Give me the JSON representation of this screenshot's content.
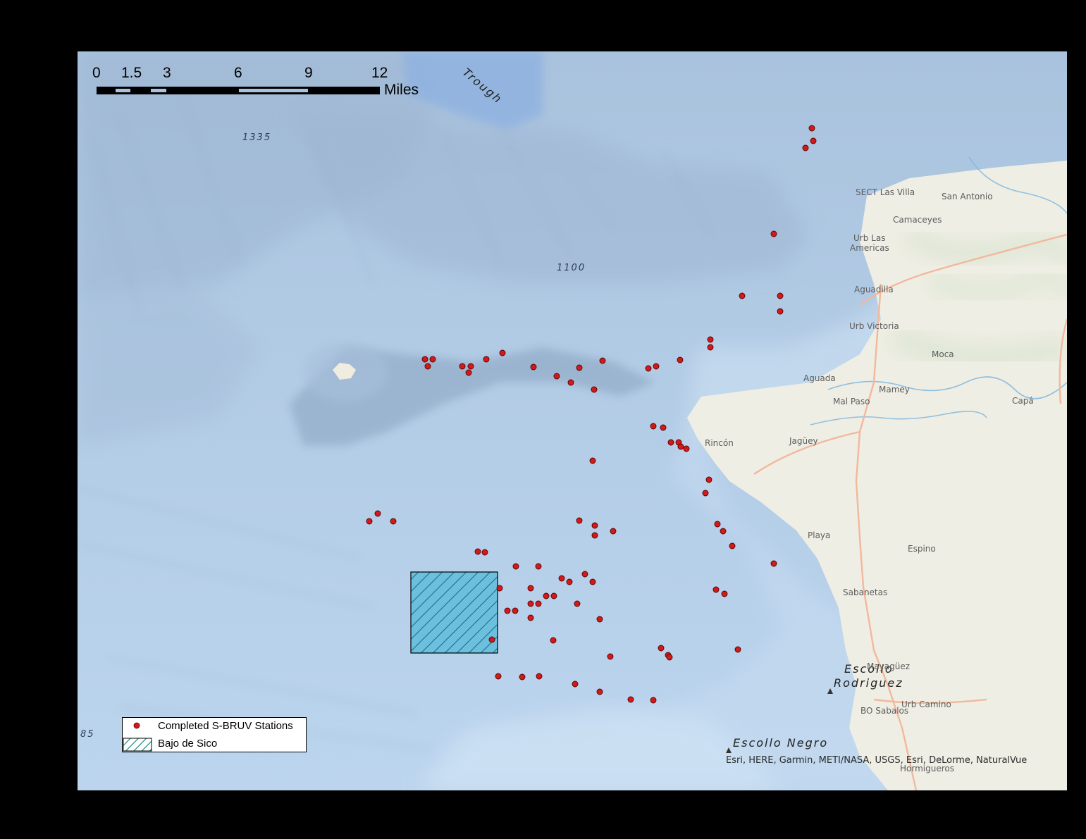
{
  "map": {
    "colors": {
      "ocean": "#b9d3ec",
      "shelf": "#cadff1",
      "trough": "#8fb2e0",
      "land": "#efeee4",
      "station": "#d11a1a",
      "study_area": "#6cc0de"
    },
    "scale_bar": {
      "ticks": [
        "0",
        "1.5",
        "3",
        "6",
        "9",
        "12"
      ],
      "unit": "Miles"
    },
    "depth_labels": [
      "1335",
      "1100",
      "85"
    ],
    "feature_labels": [
      "Trough",
      "Escollo",
      "Rodriguez",
      "Escollo Negro"
    ],
    "towns": [
      "SECT Las Villa",
      "San Antonio",
      "Camaceyes",
      "Urb Las",
      "Americas",
      "Aguadilla",
      "Urb Victoria",
      "Moca",
      "Aguada",
      "Mamey",
      "Mal Paso",
      "Capá",
      "Rincón",
      "Jagüey",
      "Playa",
      "Espino",
      "Sabanetas",
      "Mayagüez",
      "Urb Camino",
      "BO Sabalos",
      "Hormigueros"
    ],
    "attribution": "Esri, HERE, Garmin, METI/NASA, USGS, Esri, DeLorme, NaturalVue"
  },
  "legend": {
    "items": [
      {
        "label": "Completed S-BRUV Stations",
        "symbol": "red-dot"
      },
      {
        "label": "Bajo de Sico",
        "symbol": "hatched-box"
      }
    ]
  },
  "stations": [
    [
      1152,
      182
    ],
    [
      1154,
      200
    ],
    [
      1143,
      210
    ],
    [
      1098,
      332
    ],
    [
      1053,
      420
    ],
    [
      1107,
      420
    ],
    [
      1107,
      442
    ],
    [
      1008,
      482
    ],
    [
      1008,
      493
    ],
    [
      965,
      511
    ],
    [
      931,
      520
    ],
    [
      920,
      523
    ],
    [
      855,
      512
    ],
    [
      822,
      522
    ],
    [
      810,
      543
    ],
    [
      790,
      534
    ],
    [
      757,
      521
    ],
    [
      843,
      553
    ],
    [
      713,
      501
    ],
    [
      690,
      510
    ],
    [
      668,
      520
    ],
    [
      656,
      520
    ],
    [
      665,
      529
    ],
    [
      603,
      510
    ],
    [
      614,
      510
    ],
    [
      607,
      520
    ],
    [
      927,
      605
    ],
    [
      941,
      607
    ],
    [
      952,
      628
    ],
    [
      963,
      628
    ],
    [
      966,
      634
    ],
    [
      974,
      637
    ],
    [
      841,
      654
    ],
    [
      1006,
      681
    ],
    [
      1001,
      700
    ],
    [
      536,
      729
    ],
    [
      524,
      740
    ],
    [
      558,
      740
    ],
    [
      822,
      739
    ],
    [
      844,
      746
    ],
    [
      870,
      754
    ],
    [
      844,
      760
    ],
    [
      1018,
      744
    ],
    [
      1026,
      754
    ],
    [
      1039,
      775
    ],
    [
      678,
      783
    ],
    [
      688,
      784
    ],
    [
      732,
      804
    ],
    [
      764,
      804
    ],
    [
      1098,
      800
    ],
    [
      830,
      815
    ],
    [
      797,
      821
    ],
    [
      808,
      826
    ],
    [
      841,
      826
    ],
    [
      709,
      835
    ],
    [
      753,
      835
    ],
    [
      786,
      846
    ],
    [
      775,
      846
    ],
    [
      764,
      857
    ],
    [
      753,
      857
    ],
    [
      819,
      857
    ],
    [
      720,
      867
    ],
    [
      731,
      867
    ],
    [
      753,
      877
    ],
    [
      851,
      879
    ],
    [
      1016,
      837
    ],
    [
      1028,
      843
    ],
    [
      698,
      908
    ],
    [
      785,
      909
    ],
    [
      938,
      920
    ],
    [
      948,
      930
    ],
    [
      950,
      933
    ],
    [
      1047,
      922
    ],
    [
      866,
      932
    ],
    [
      707,
      960
    ],
    [
      741,
      961
    ],
    [
      765,
      960
    ],
    [
      816,
      971
    ],
    [
      851,
      982
    ],
    [
      895,
      993
    ],
    [
      927,
      994
    ]
  ]
}
